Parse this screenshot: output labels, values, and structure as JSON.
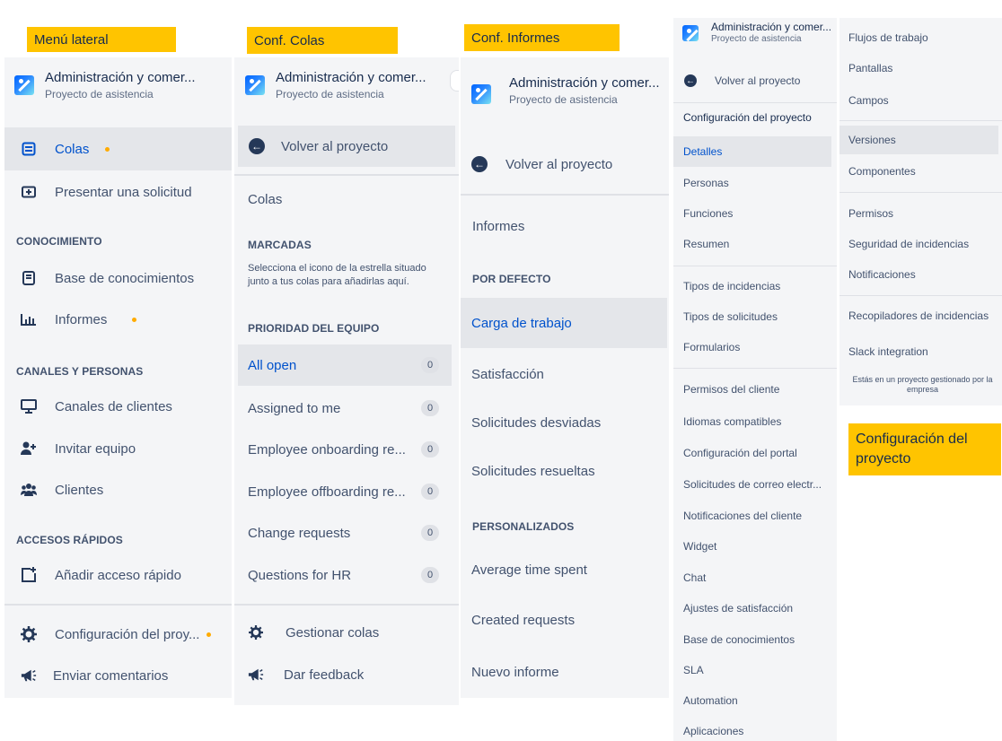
{
  "tags": {
    "menu": "Menú lateral",
    "colas": "Conf. Colas",
    "informes": "Conf. Informes",
    "config": "Configuración del proyecto"
  },
  "project": {
    "name": "Administración y comer...",
    "subtitle": "Proyecto de asistencia"
  },
  "sidebar": {
    "items": [
      {
        "label": "Colas",
        "icon": "queue-icon"
      },
      {
        "label": "Presentar una solicitud",
        "icon": "add-request-icon"
      }
    ],
    "knowledge_heading": "CONOCIMIENTO",
    "knowledge_items": [
      {
        "label": "Base de conocimientos",
        "icon": "book-icon"
      },
      {
        "label": "Informes",
        "icon": "bar-chart-icon"
      }
    ],
    "channels_heading": "CANALES Y PERSONAS",
    "channels_items": [
      {
        "label": "Canales de clientes",
        "icon": "monitor-icon"
      },
      {
        "label": "Invitar equipo",
        "icon": "invite-icon"
      },
      {
        "label": "Clientes",
        "icon": "people-icon"
      }
    ],
    "shortcuts_heading": "ACCESOS RÁPIDOS",
    "add_shortcut": "Añadir acceso rápido",
    "footer": {
      "settings": "Configuración del proy...",
      "feedback": "Enviar comentarios"
    },
    "accent_dot_color": "#ffab00"
  },
  "colas": {
    "back": "Volver al proyecto",
    "title": "Colas",
    "starred_heading": "MARCADAS",
    "starred_hint": "Selecciona el icono de la estrella situado junto a tus colas para añadirlas aquí.",
    "team_heading": "PRIORIDAD DEL EQUIPO",
    "queues": [
      {
        "label": "All open",
        "count": "0"
      },
      {
        "label": "Assigned to me",
        "count": "0"
      },
      {
        "label": "Employee onboarding re...",
        "count": "0"
      },
      {
        "label": "Employee offboarding re...",
        "count": "0"
      },
      {
        "label": "Change requests",
        "count": "0"
      },
      {
        "label": "Questions for HR",
        "count": "0"
      }
    ],
    "manage": "Gestionar colas",
    "feedback": "Dar feedback"
  },
  "informes": {
    "back": "Volver al proyecto",
    "title": "Informes",
    "default_heading": "POR DEFECTO",
    "default_items": [
      "Carga de trabajo",
      "Satisfacción",
      "Solicitudes desviadas",
      "Solicitudes resueltas"
    ],
    "custom_heading": "PERSONALIZADOS",
    "custom_items": [
      "Average time spent",
      "Created requests",
      "Nuevo informe"
    ]
  },
  "config": {
    "back": "Volver al proyecto",
    "heading": "Configuración del proyecto",
    "group1": [
      "Detalles",
      "Personas",
      "Funciones",
      "Resumen"
    ],
    "group2": [
      "Tipos de incidencias",
      "Tipos de solicitudes",
      "Formularios"
    ],
    "group3": [
      "Permisos del cliente",
      "Idiomas compatibles",
      "Configuración del portal",
      "Solicitudes de correo electr...",
      "Notificaciones del cliente",
      "Widget",
      "Chat",
      "Ajustes de satisfacción",
      "Base de conocimientos",
      "SLA",
      "Automation",
      "Aplicaciones"
    ],
    "right_group1": [
      "Flujos de trabajo",
      "Pantallas",
      "Campos"
    ],
    "right_group2": [
      "Versiones",
      "Componentes"
    ],
    "right_group3": [
      "Permisos",
      "Seguridad de incidencias",
      "Notificaciones"
    ],
    "right_group4": [
      "Recopiladores de incidencias",
      "Slack integration"
    ],
    "footer_note": "Estás en un proyecto gestionado por la empresa"
  }
}
